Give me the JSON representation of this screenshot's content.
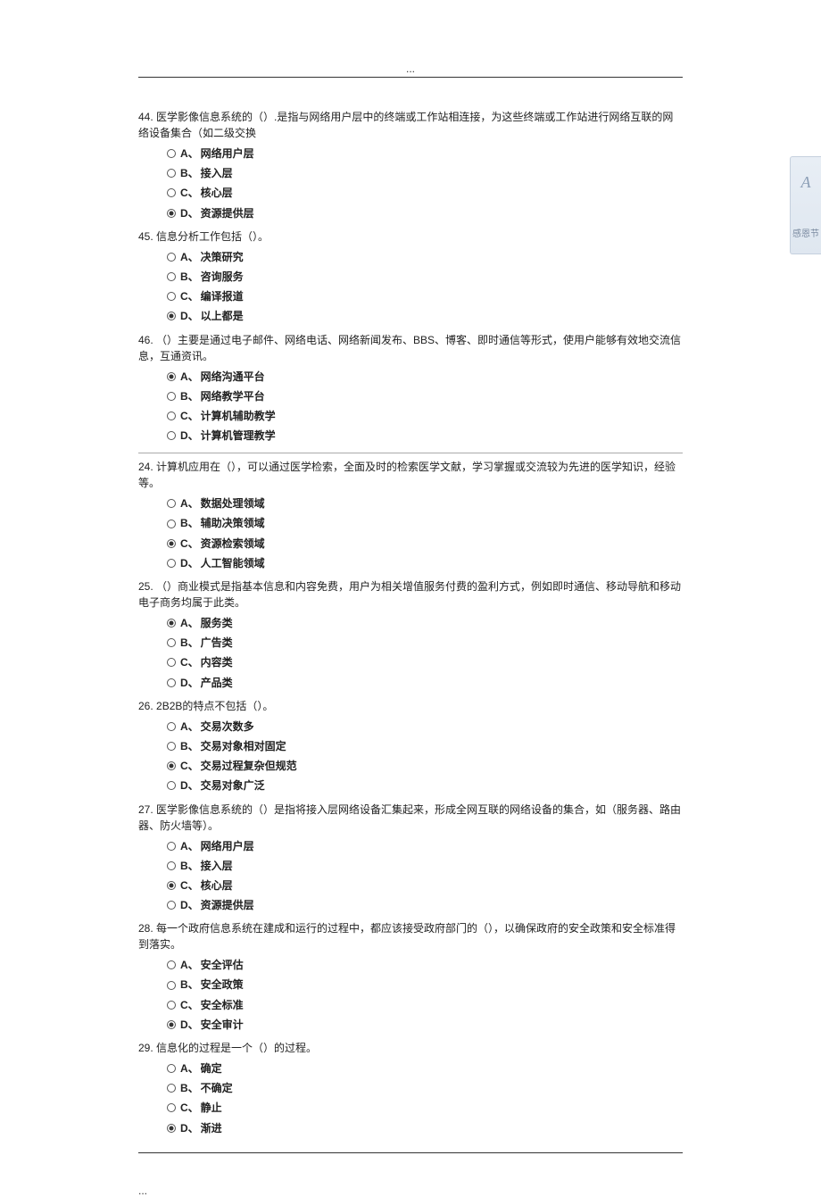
{
  "header": "...",
  "sidebar": {
    "letter": "A",
    "label": "感恩节"
  },
  "questions": [
    {
      "num": "44.",
      "text": "医学影像信息系统的（）.是指与网络用户层中的终端或工作站相连接，为这些终端或工作站进行网络互联的网络设备集合（如二级交换",
      "options": [
        {
          "letter": "A、",
          "text": "网络用户层",
          "selected": false
        },
        {
          "letter": "B、",
          "text": "接入层",
          "selected": false
        },
        {
          "letter": "C、",
          "text": "核心层",
          "selected": false
        },
        {
          "letter": "D、",
          "text": "资源提供层",
          "selected": true
        }
      ]
    },
    {
      "num": "45.",
      "text": "信息分析工作包括（）。",
      "options": [
        {
          "letter": "A、",
          "text": "决策研究",
          "selected": false
        },
        {
          "letter": "B、",
          "text": "咨询服务",
          "selected": false
        },
        {
          "letter": "C、",
          "text": "编译报道",
          "selected": false
        },
        {
          "letter": "D、",
          "text": "以上都是",
          "selected": true
        }
      ]
    },
    {
      "num": "46.",
      "text": "（）主要是通过电子邮件、网络电话、网络新闻发布、BBS、博客、即时通信等形式，使用户能够有效地交流信息，互通资讯。",
      "options": [
        {
          "letter": "A、",
          "text": "网络沟通平台",
          "selected": true
        },
        {
          "letter": "B、",
          "text": "网络教学平台",
          "selected": false
        },
        {
          "letter": "C、",
          "text": "计算机辅助教学",
          "selected": false
        },
        {
          "letter": "D、",
          "text": "计算机管理教学",
          "selected": false
        }
      ]
    },
    {
      "divider": true,
      "num": "24.",
      "text": "计算机应用在（），可以通过医学检索，全面及时的检索医学文献，学习掌握或交流较为先进的医学知识，经验等。",
      "options": [
        {
          "letter": "A、",
          "text": "数据处理领域",
          "selected": false
        },
        {
          "letter": "B、",
          "text": "辅助决策领域",
          "selected": false
        },
        {
          "letter": "C、",
          "text": "资源检索领域",
          "selected": true
        },
        {
          "letter": "D、",
          "text": "人工智能领域",
          "selected": false
        }
      ]
    },
    {
      "num": "25.",
      "text": "（）商业模式是指基本信息和内容免费，用户为相关增值服务付费的盈利方式，例如即时通信、移动导航和移动电子商务均属于此类。",
      "options": [
        {
          "letter": "A、",
          "text": "服务类",
          "selected": true
        },
        {
          "letter": "B、",
          "text": "广告类",
          "selected": false
        },
        {
          "letter": "C、",
          "text": "内容类",
          "selected": false
        },
        {
          "letter": "D、",
          "text": "产品类",
          "selected": false
        }
      ]
    },
    {
      "num": "26.",
      "text": "2B2B的特点不包括（）。",
      "options": [
        {
          "letter": "A、",
          "text": "交易次数多",
          "selected": false
        },
        {
          "letter": "B、",
          "text": "交易对象相对固定",
          "selected": false
        },
        {
          "letter": "C、",
          "text": "交易过程复杂但规范",
          "selected": true
        },
        {
          "letter": "D、",
          "text": "交易对象广泛",
          "selected": false
        }
      ]
    },
    {
      "num": "27.",
      "text": "医学影像信息系统的（）是指将接入层网络设备汇集起来，形成全网互联的网络设备的集合，如（服务器、路由器、防火墙等）。",
      "options": [
        {
          "letter": "A、",
          "text": "网络用户层",
          "selected": false
        },
        {
          "letter": "B、",
          "text": "接入层",
          "selected": false
        },
        {
          "letter": "C、",
          "text": "核心层",
          "selected": true
        },
        {
          "letter": "D、",
          "text": "资源提供层",
          "selected": false
        }
      ]
    },
    {
      "num": "28.",
      "text": "每一个政府信息系统在建成和运行的过程中，都应该接受政府部门的（），以确保政府的安全政策和安全标准得到落实。",
      "options": [
        {
          "letter": "A、",
          "text": "安全评估",
          "selected": false
        },
        {
          "letter": "B、",
          "text": "安全政策",
          "selected": false
        },
        {
          "letter": "C、",
          "text": "安全标准",
          "selected": false
        },
        {
          "letter": "D、",
          "text": "安全审计",
          "selected": true
        }
      ]
    },
    {
      "num": "29.",
      "text": "信息化的过程是一个（）的过程。",
      "options": [
        {
          "letter": "A、",
          "text": "确定",
          "selected": false
        },
        {
          "letter": "B、",
          "text": "不确定",
          "selected": false
        },
        {
          "letter": "C、",
          "text": "静止",
          "selected": false
        },
        {
          "letter": "D、",
          "text": "渐进",
          "selected": true
        }
      ]
    }
  ],
  "footer": "..."
}
